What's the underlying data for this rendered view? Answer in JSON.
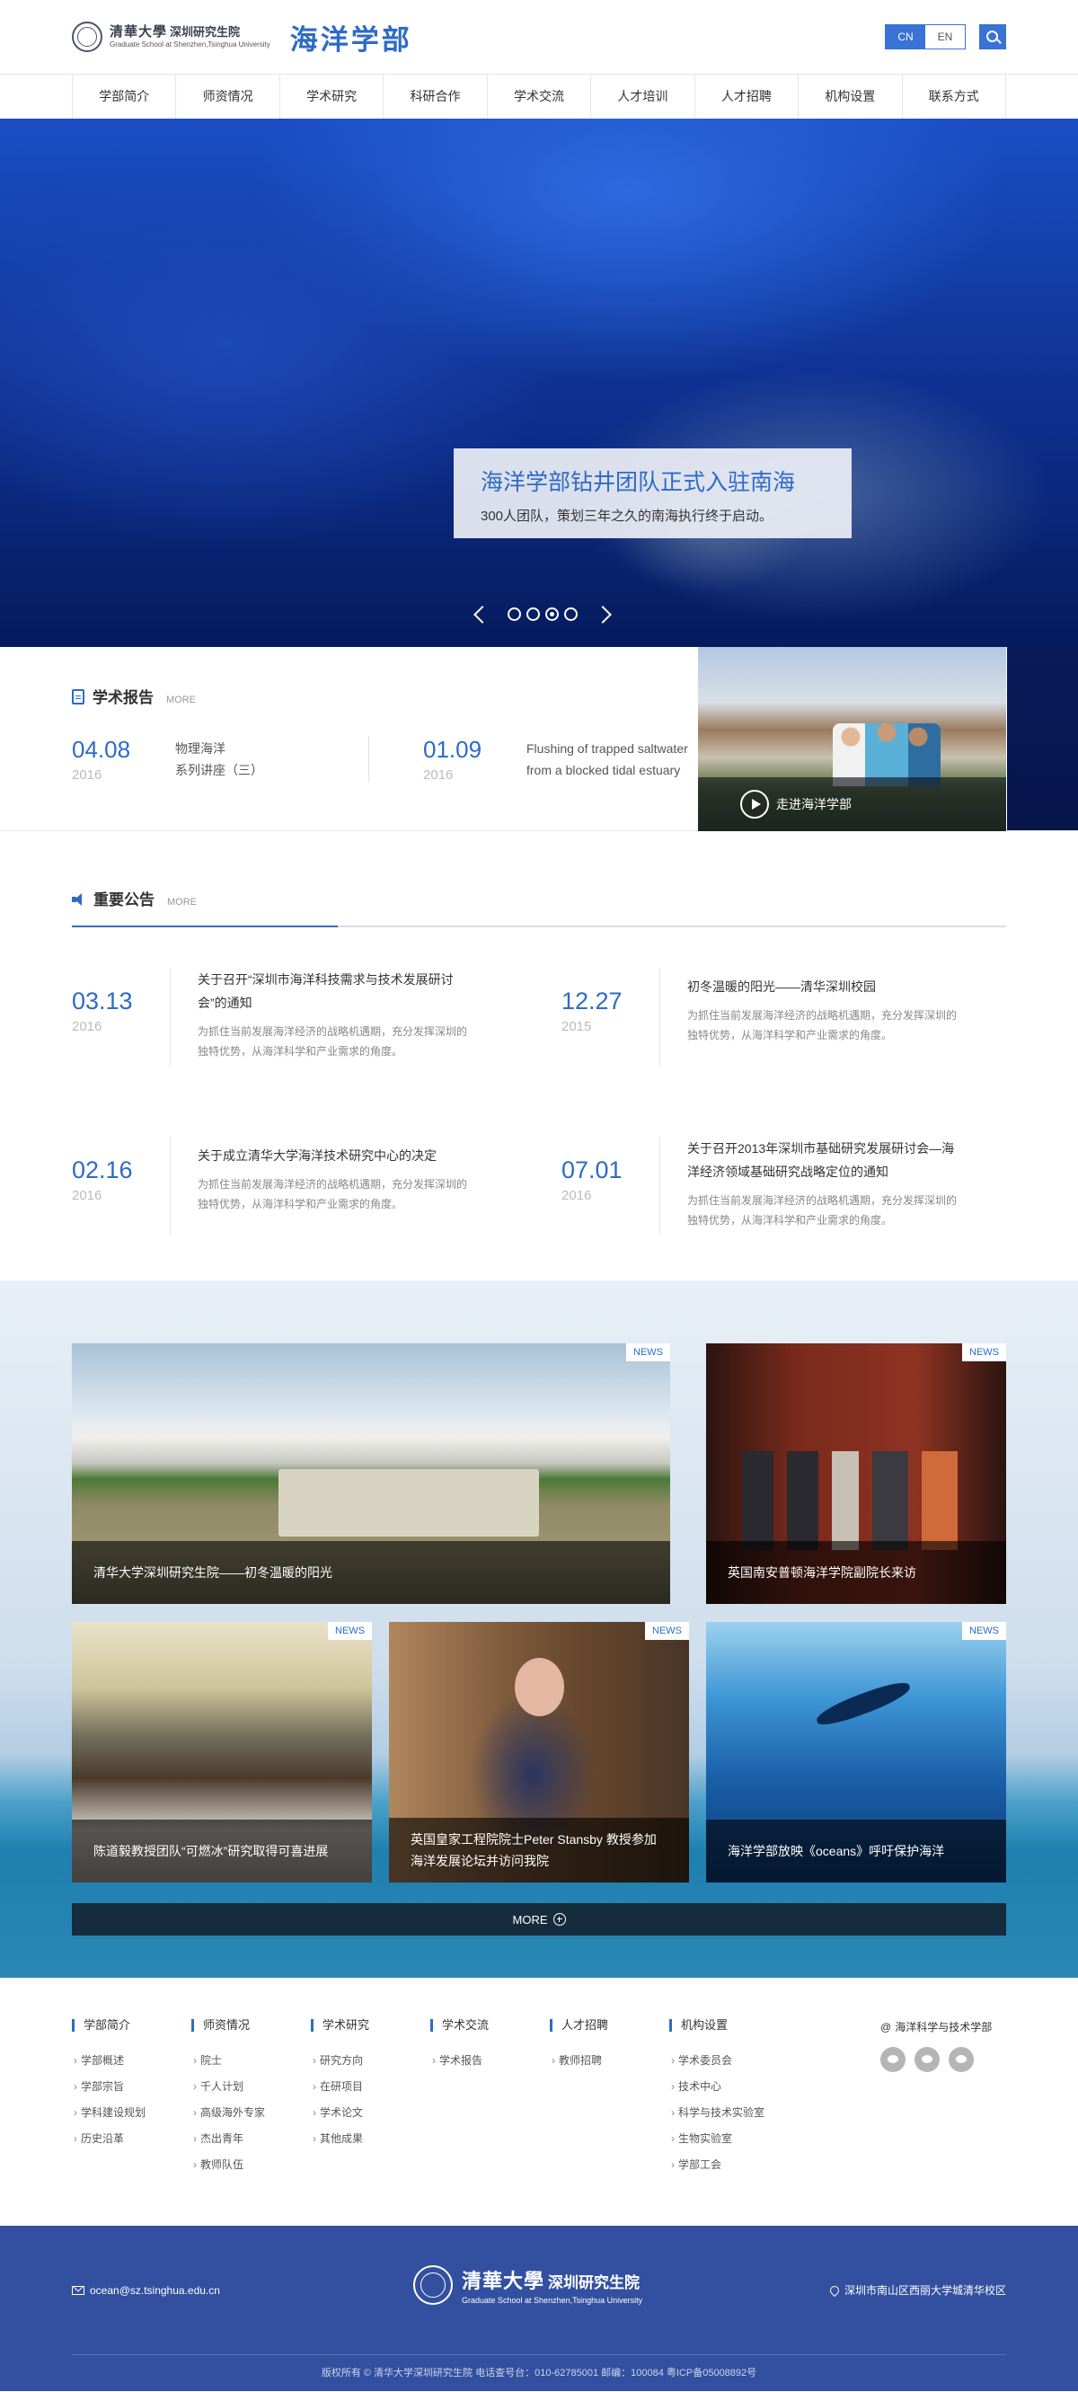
{
  "header": {
    "logo_cn": "清華大學",
    "logo_cn_sub": "深圳研究生院",
    "logo_en": "Graduate School at Shenzhen,Tsinghua University",
    "dept_name": "海洋学部",
    "lang_cn": "CN",
    "lang_en": "EN",
    "accent_color": "#2e6bc6"
  },
  "nav": [
    "学部简介",
    "师资情况",
    "学术研究",
    "科研合作",
    "学术交流",
    "人才培训",
    "人才招聘",
    "机构设置",
    "联系方式"
  ],
  "hero": {
    "title": "海洋学部钻井团队正式入驻南海",
    "subtitle": "300人团队，策划三年之久的南海执行终于启动。",
    "dot_count": 4,
    "active_dot": 3
  },
  "reports": {
    "title": "学术报告",
    "more": "MORE",
    "items": [
      {
        "md": "04.08",
        "year": "2016",
        "text": "物理海洋\n系列讲座（三）"
      },
      {
        "md": "01.09",
        "year": "2016",
        "text": "Flushing of trapped saltwater from a blocked tidal estuary"
      }
    ],
    "visit_label": "走进海洋学部"
  },
  "notices": {
    "title": "重要公告",
    "more": "MORE",
    "items": [
      {
        "md": "03.13",
        "year": "2016",
        "title": "关于召开“深圳市海洋科技需求与技术发展研讨会”的通知",
        "desc": "为抓住当前发展海洋经济的战略机遇期，充分发挥深圳的独特优势，从海洋科学和产业需求的角度。"
      },
      {
        "md": "12.27",
        "year": "2015",
        "title": "初冬温暖的阳光——清华深圳校园",
        "desc": "为抓住当前发展海洋经济的战略机遇期，充分发挥深圳的独特优势，从海洋科学和产业需求的角度。"
      },
      {
        "md": "02.16",
        "year": "2016",
        "title": "关于成立清华大学海洋技术研究中心的决定",
        "desc": "为抓住当前发展海洋经济的战略机遇期，充分发挥深圳的独特优势，从海洋科学和产业需求的角度。"
      },
      {
        "md": "07.01",
        "year": "2016",
        "title": "关于召开2013年深圳市基础研究发展研讨会—海洋经济领域基础研究战略定位的通知",
        "desc": "为抓住当前发展海洋经济的战略机遇期，充分发挥深圳的独特优势，从海洋科学和产业需求的角度。"
      }
    ]
  },
  "news": {
    "tag": "NEWS",
    "items": [
      "清华大学深圳研究生院——初冬温暖的阳光",
      "英国南安普顿海洋学院副院长来访",
      "陈道毅教授团队“可燃冰”研究取得可喜进展",
      "英国皇家工程院院士Peter Stansby 教授参加海洋发展论坛并访问我院",
      "海洋学部放映《oceans》呼吁保护海洋"
    ],
    "more": "MORE"
  },
  "footer_links": {
    "columns": [
      {
        "title": "学部简介",
        "items": [
          "学部概述",
          "学部宗旨",
          "学科建设规划",
          "历史沿革"
        ]
      },
      {
        "title": "师资情况",
        "items": [
          "院士",
          "千人计划",
          "高级海外专家",
          "杰出青年",
          "教师队伍"
        ]
      },
      {
        "title": "学术研究",
        "items": [
          "研究方向",
          "在研项目",
          "学术论文",
          "其他成果"
        ]
      },
      {
        "title": "学术交流",
        "items": [
          "学术报告"
        ]
      },
      {
        "title": "人才招聘",
        "items": [
          "教师招聘"
        ]
      },
      {
        "title": "机构设置",
        "items": [
          "学术委员会",
          "技术中心",
          "科学与技术实验室",
          "生物实验室",
          "学部工会"
        ]
      }
    ],
    "social_title": "海洋科学与技术学部"
  },
  "footbar": {
    "email": "ocean@sz.tsinghua.edu.cn",
    "logo_cn": "清華大學",
    "logo_cn_sub": "深圳研究生院",
    "logo_en": "Graduate School at Shenzhen,Tsinghua University",
    "address": "深圳市南山区西丽大学城清华校区",
    "copyright": "版权所有 © 清华大学深圳研究生院 电话查号台：010-62785001 邮编：100084 粤ICP备05008892号"
  }
}
